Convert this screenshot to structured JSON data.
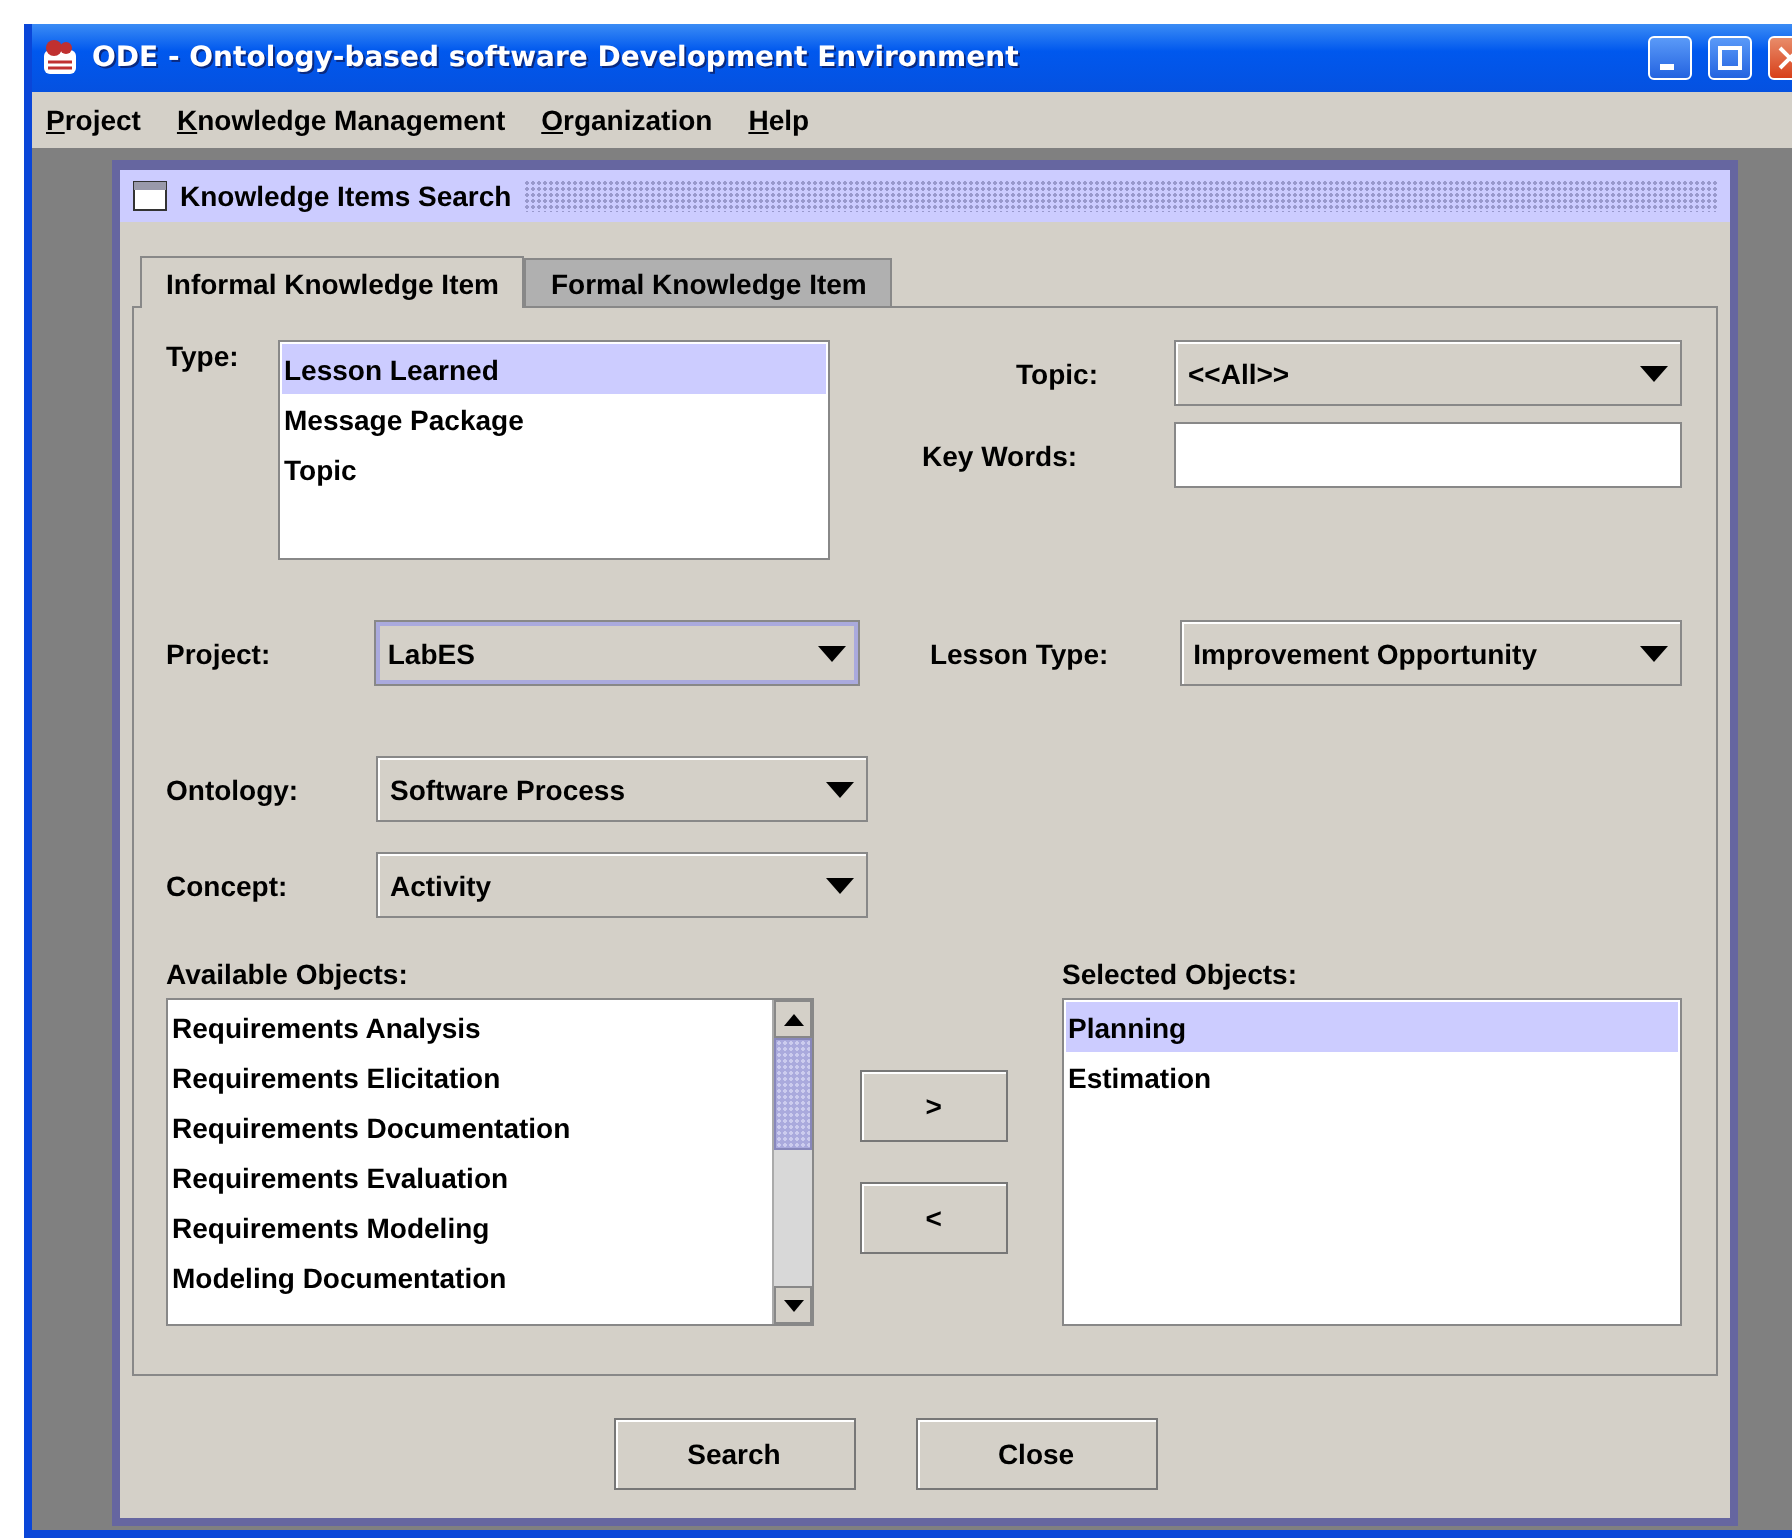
{
  "window": {
    "title": "ODE - Ontology-based software Development Environment"
  },
  "menu": [
    "Project",
    "Knowledge Management",
    "Organization",
    "Help"
  ],
  "dialog": {
    "title": "Knowledge Items Search",
    "tabs": [
      {
        "label": "Informal Knowledge Item",
        "selected": true
      },
      {
        "label": "Formal Knowledge Item",
        "selected": false
      }
    ],
    "type": {
      "label": "Type:",
      "items": [
        {
          "label": "Lesson Learned",
          "selected": true
        },
        {
          "label": "Message Package",
          "selected": false
        },
        {
          "label": "Topic",
          "selected": false
        }
      ]
    },
    "topic": {
      "label": "Topic:",
      "value": "<<All>>"
    },
    "key_words": {
      "label": "Key Words:"
    },
    "project": {
      "label": "Project:",
      "value": "LabES",
      "focused": true
    },
    "lesson_type": {
      "label": "Lesson Type:",
      "value": "Improvement Opportunity"
    },
    "ontology": {
      "label": "Ontology:",
      "value": "Software Process"
    },
    "concept": {
      "label": "Concept:",
      "value": "Activity"
    },
    "available": {
      "label": "Available Objects:",
      "items": [
        {
          "label": "Requirements Analysis",
          "selected": false
        },
        {
          "label": "Requirements Elicitation",
          "selected": false
        },
        {
          "label": "Requirements Documentation",
          "selected": false
        },
        {
          "label": "Requirements Evaluation",
          "selected": false
        },
        {
          "label": "Requirements Modeling",
          "selected": false
        },
        {
          "label": "Modeling Documentation",
          "selected": false
        }
      ]
    },
    "move_buttons": [
      ">",
      "<"
    ],
    "selected_objects": {
      "label": "Selected Objects:",
      "items": [
        {
          "label": "Planning",
          "selected": true
        },
        {
          "label": "Estimation",
          "selected": false
        }
      ]
    },
    "buttons": [
      "Search",
      "Close"
    ]
  }
}
